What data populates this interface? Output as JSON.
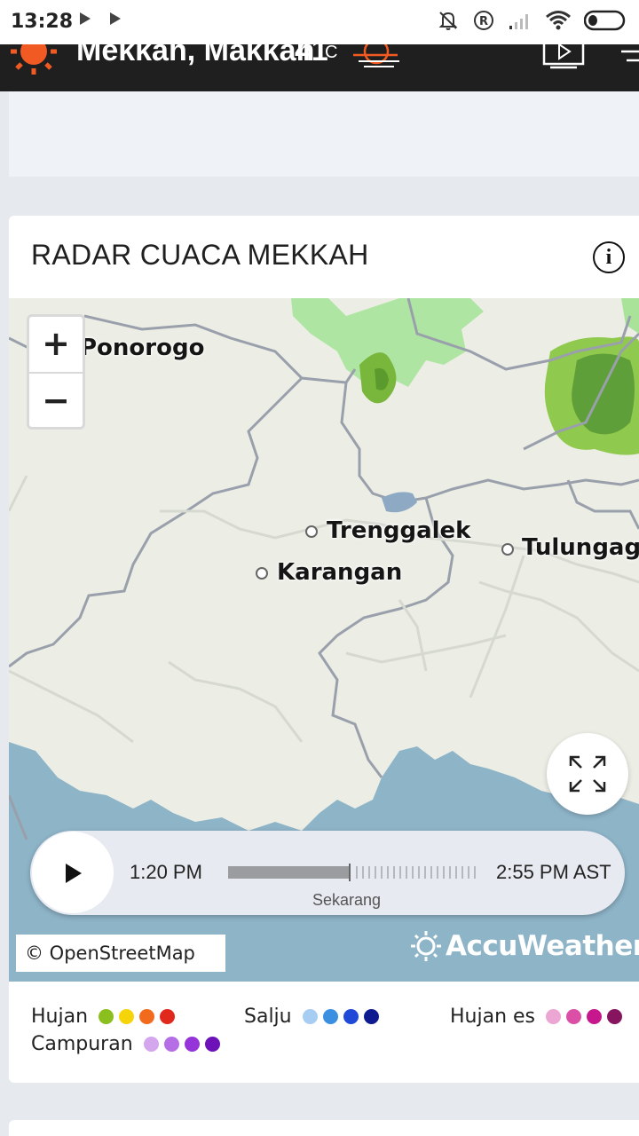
{
  "status_bar": {
    "time": "13:28",
    "icons": [
      "play-store-icon",
      "play-store-icon",
      "bell-muted-icon",
      "registered-icon",
      "signal-icon",
      "wifi-icon",
      "battery-icon"
    ]
  },
  "header": {
    "location": "Mekkah, Makkah",
    "temperature": "41",
    "unit": "C",
    "icons": [
      "sun-logo-icon",
      "haze-icon",
      "video-icon",
      "menu-icon"
    ]
  },
  "radar": {
    "title": "RADAR CUACA MEKKAH",
    "info_label": "i",
    "map": {
      "places": [
        "Ponorogo",
        "Trenggalek",
        "Karangan",
        "Tulungagu"
      ],
      "zoom_in": "+",
      "zoom_out": "−"
    },
    "player": {
      "start_time": "1:20 PM",
      "end_time": "2:55 PM AST",
      "now_label": "Sekarang",
      "progress": 0.49
    },
    "attribution": "© OpenStreetMap",
    "brand": "AccuWeather"
  },
  "legend": {
    "rain": {
      "label": "Hujan",
      "colors": [
        "#8bbf1d",
        "#f5d40a",
        "#f26b1d",
        "#e0291c"
      ]
    },
    "snow": {
      "label": "Salju",
      "colors": [
        "#a8cdf2",
        "#3b8fe0",
        "#1f49d6",
        "#0e1a8f"
      ]
    },
    "ice": {
      "label": "Hujan es",
      "colors": [
        "#eba6d3",
        "#dc4fa7",
        "#c6178d",
        "#87145e"
      ]
    },
    "mix": {
      "label": "Campuran",
      "colors": [
        "#d3a6ee",
        "#b56ee6",
        "#9534d8",
        "#6d11b9"
      ]
    }
  }
}
